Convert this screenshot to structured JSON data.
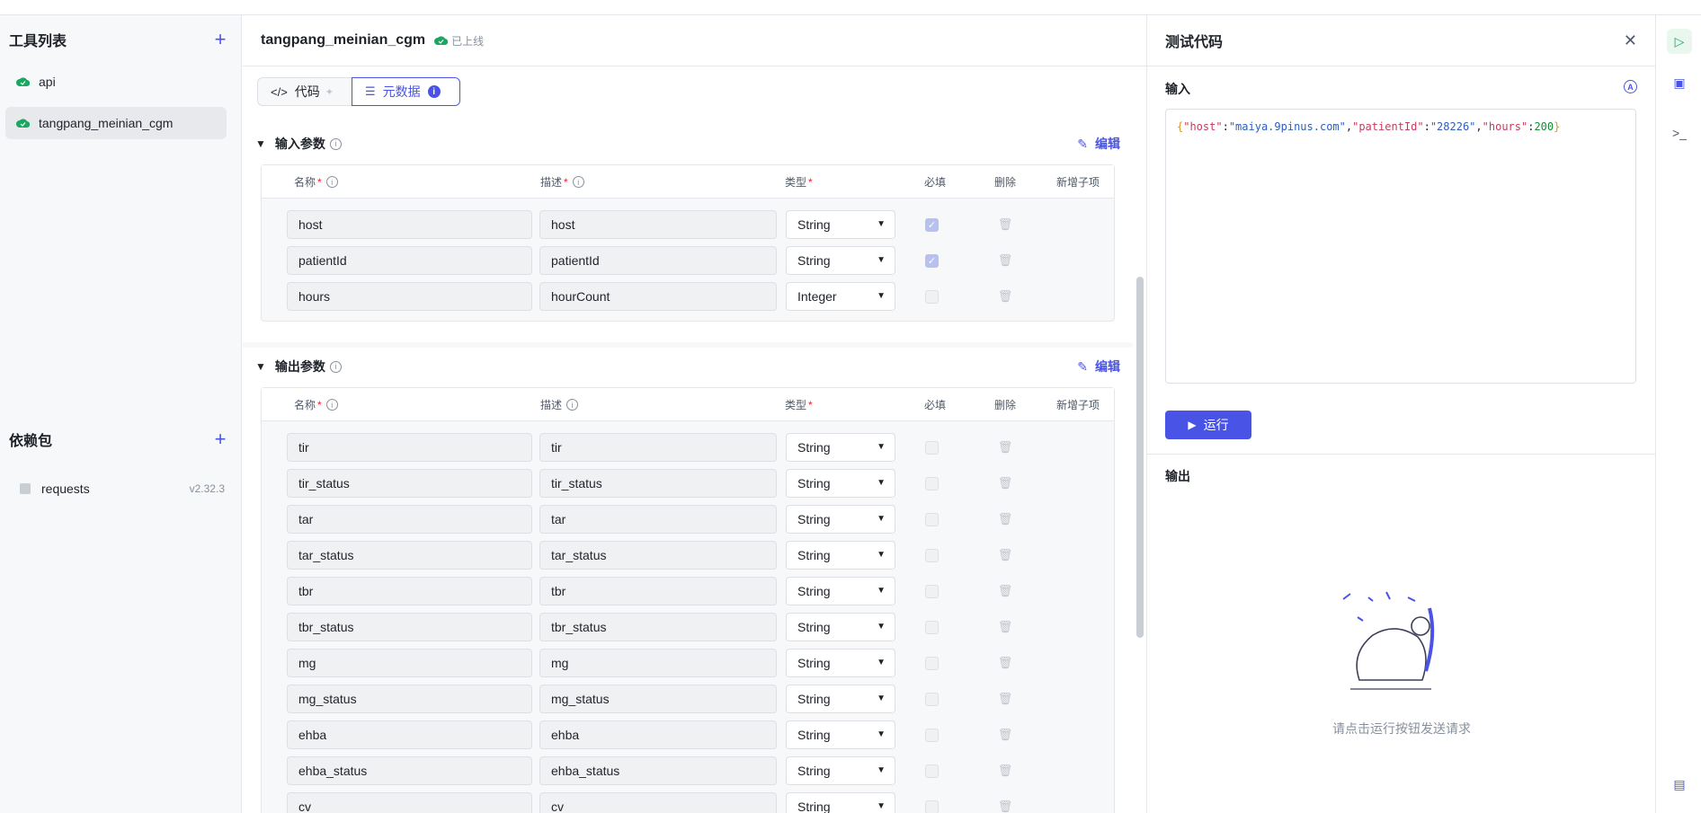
{
  "sidebar": {
    "tools_title": "工具列表",
    "tools": [
      {
        "label": "api",
        "active": false
      },
      {
        "label": "tangpang_meinian_cgm",
        "active": true
      }
    ],
    "deps_title": "依赖包",
    "packages": [
      {
        "name": "requests",
        "version": "v2.32.3"
      }
    ]
  },
  "header": {
    "title": "tangpang_meinian_cgm",
    "status": "已上线"
  },
  "tabs": [
    {
      "label": "代码",
      "icon": "code-icon"
    },
    {
      "label": "元数据",
      "icon": "sliders-icon",
      "badge": "i"
    }
  ],
  "input_params": {
    "title": "输入参数",
    "edit_label": "编辑",
    "columns": {
      "name": "名称",
      "desc": "描述",
      "type": "类型",
      "required": "必填",
      "delete": "删除",
      "add_child": "新增子项"
    },
    "rows": [
      {
        "name": "host",
        "desc": "host",
        "type": "String",
        "required": true
      },
      {
        "name": "patientId",
        "desc": "patientId",
        "type": "String",
        "required": true
      },
      {
        "name": "hours",
        "desc": "hourCount",
        "type": "Integer",
        "required": false
      }
    ]
  },
  "output_params": {
    "title": "输出参数",
    "edit_label": "编辑",
    "columns": {
      "name": "名称",
      "desc": "描述",
      "type": "类型",
      "required": "必填",
      "delete": "删除",
      "add_child": "新增子项"
    },
    "rows": [
      {
        "name": "tir",
        "desc": "tir",
        "type": "String"
      },
      {
        "name": "tir_status",
        "desc": "tir_status",
        "type": "String"
      },
      {
        "name": "tar",
        "desc": "tar",
        "type": "String"
      },
      {
        "name": "tar_status",
        "desc": "tar_status",
        "type": "String"
      },
      {
        "name": "tbr",
        "desc": "tbr",
        "type": "String"
      },
      {
        "name": "tbr_status",
        "desc": "tbr_status",
        "type": "String"
      },
      {
        "name": "mg",
        "desc": "mg",
        "type": "String"
      },
      {
        "name": "mg_status",
        "desc": "mg_status",
        "type": "String"
      },
      {
        "name": "ehba",
        "desc": "ehba",
        "type": "String"
      },
      {
        "name": "ehba_status",
        "desc": "ehba_status",
        "type": "String"
      },
      {
        "name": "cv",
        "desc": "cv",
        "type": "String"
      }
    ]
  },
  "test_panel": {
    "title": "测试代码",
    "input_label": "输入",
    "input_json": {
      "k1": "\"host\"",
      "v1": "\"maiya.9pinus.com\"",
      "k2": "\"patientId\"",
      "v2": "\"28226\"",
      "k3": "\"hours\"",
      "v3": "200"
    },
    "run_label": "运行",
    "output_label": "输出",
    "empty_text": "请点击运行按钮发送请求"
  },
  "colors": {
    "accent": "#4954e6",
    "online": "#1aa760"
  }
}
